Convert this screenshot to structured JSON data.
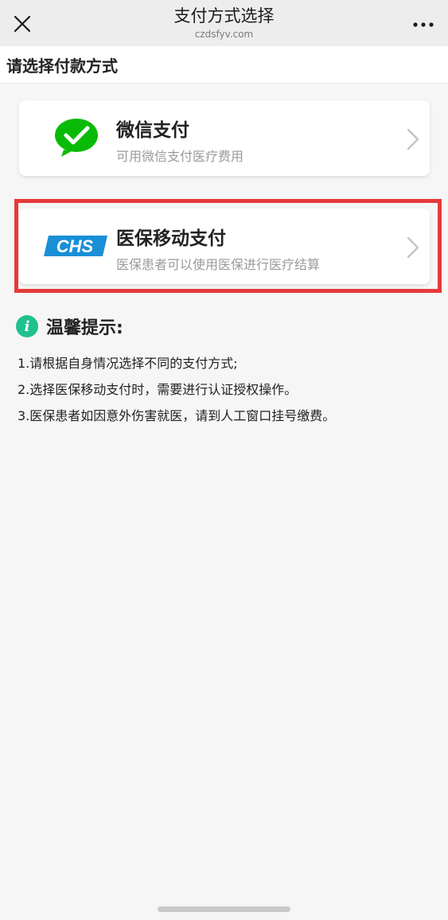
{
  "header": {
    "title": "支付方式选择",
    "subtitle": "czdsfyv.com",
    "close_icon": "close-icon",
    "more_icon": "more-icon"
  },
  "section": {
    "title": "请选择付款方式"
  },
  "payment_methods": [
    {
      "name": "微信支付",
      "desc": "可用微信支付医疗费用",
      "icon": "wechat-pay-icon",
      "color": "#09bb07"
    },
    {
      "name": "医保移动支付",
      "desc": "医保患者可以使用医保进行医疗结算",
      "icon": "chs-logo",
      "logo_text": "CHS",
      "color": "#1a8fd6"
    }
  ],
  "tips": {
    "title": "温馨提示:",
    "items": [
      "1.请根据自身情况选择不同的支付方式;",
      "2.选择医保移动支付时，需要进行认证授权操作。",
      "3.医保患者如因意外伤害就医，请到人工窗口挂号缴费。"
    ]
  },
  "highlight_color": "#e53a3a"
}
